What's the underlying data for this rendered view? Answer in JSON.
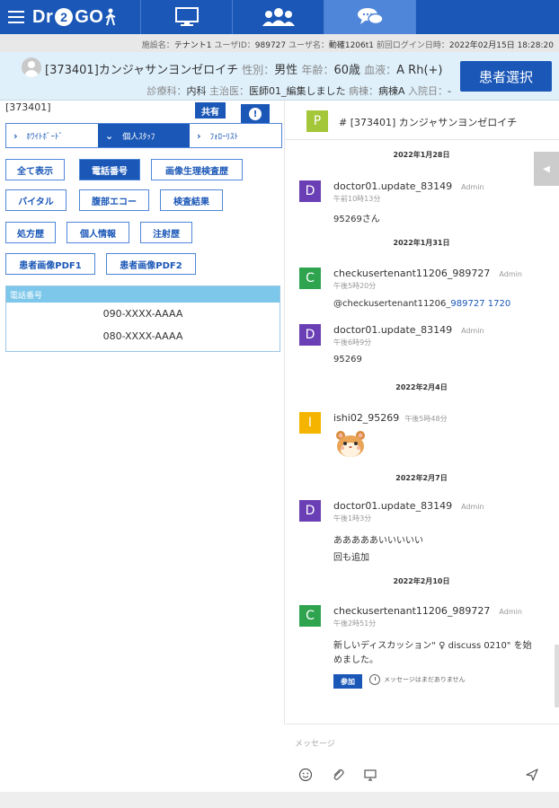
{
  "app": {
    "logo_pre": "Dr",
    "logo_two": "2",
    "logo_post": "GO"
  },
  "nav": {
    "tabs": [
      {
        "name": "monitor",
        "icon": "monitor-icon"
      },
      {
        "name": "users",
        "icon": "group-users-icon"
      },
      {
        "name": "chat",
        "icon": "chat-bubbles-icon",
        "active": true
      },
      {
        "name": "empty",
        "icon": ""
      }
    ]
  },
  "infoline": {
    "facility_label": "施設名：",
    "facility": "テナント1",
    "userid_label": "ユーザID：",
    "userid": "989727",
    "username_label": "ユーザ名：",
    "username": "動確1206t1",
    "lastlogin_label": "前回ログイン日時：",
    "lastlogin": "2022年02月15日 18:28:20"
  },
  "patient": {
    "id_name": "[373401]カンジャサンヨンゼロイチ",
    "sex_label": "性別：",
    "sex": "男性",
    "age_label": "年齢：",
    "age": "60歳",
    "blood_label": "血液：",
    "blood": "A Rh(+)",
    "dept_label": "診療科：",
    "dept": "内科",
    "doctor_label": "主治医：",
    "doctor": "医師01_編集しました",
    "ward_label": "病棟：",
    "ward": "病棟A",
    "admit_label": "入院日：",
    "admit": "-",
    "select_button": "患者選択"
  },
  "left": {
    "patient_id": "[373401]",
    "share_button": "共有",
    "info_button": "!",
    "subtabs": [
      {
        "label": "ﾎﾜｲﾄﾎﾞｰﾄﾞ",
        "active": false
      },
      {
        "label": "個人ｽﾀｯﾌ",
        "active": true
      },
      {
        "label": "ﾌｫﾛｰﾘｽﾄ",
        "active": false
      }
    ],
    "filters": [
      {
        "label": "全て表示",
        "active": false
      },
      {
        "label": "電話番号",
        "active": true
      },
      {
        "label": "画像生理検査歴",
        "active": false
      },
      {
        "label": "バイタル",
        "active": false
      },
      {
        "label": "腹部エコー",
        "active": false
      },
      {
        "label": "検査結果",
        "active": false
      },
      {
        "label": "処方歴",
        "active": false
      },
      {
        "label": "個人情報",
        "active": false
      },
      {
        "label": "注射歴",
        "active": false
      },
      {
        "label": "患者画像PDF1",
        "active": false
      },
      {
        "label": "患者画像PDF2",
        "active": false
      }
    ],
    "phone_header": "電話番号",
    "phones": [
      "090-XXXX-AAAA",
      "080-XXXX-AAAA"
    ]
  },
  "chat": {
    "channel_icon": "P",
    "channel_name": "# [373401] カンジャサンヨンゼロイチ",
    "dates": [
      "2022年1月28日",
      "2022年1月31日",
      "2022年2月4日",
      "2022年2月7日",
      "2022年2月10日"
    ],
    "messages": [
      {
        "avatar": "D",
        "author": "doctor01.update_83149",
        "role": "Admin",
        "time": "午前10時13分",
        "lines": [
          "95269さん"
        ]
      },
      {
        "avatar": "C",
        "author": "checkusertenant11206_989727",
        "role": "Admin",
        "time": "午後5時20分",
        "lines": [
          "@checkusertenant11206_",
          "989727 1720"
        ]
      },
      {
        "avatar": "D",
        "author": "doctor01.update_83149",
        "role": "Admin",
        "time": "午後6時9分",
        "lines": [
          "95269"
        ]
      },
      {
        "avatar": "I",
        "author": "ishi02_95269",
        "role": "",
        "time": "午後5時48分",
        "lines": []
      },
      {
        "avatar": "D",
        "author": "doctor01.update_83149",
        "role": "Admin",
        "time": "午後1時3分",
        "lines": [
          "あああああいいいいい",
          "回も追加"
        ]
      },
      {
        "avatar": "C",
        "author": "checkusertenant11206_989727",
        "role": "Admin",
        "time": "午後2時51分",
        "lines": [
          "新しいディスカッション\" ♀ discuss 0210\" を始",
          "めました。"
        ]
      }
    ],
    "join_button": "参加",
    "no_reply": "メッセージはまだありません",
    "composer_placeholder": "メッセージ"
  }
}
